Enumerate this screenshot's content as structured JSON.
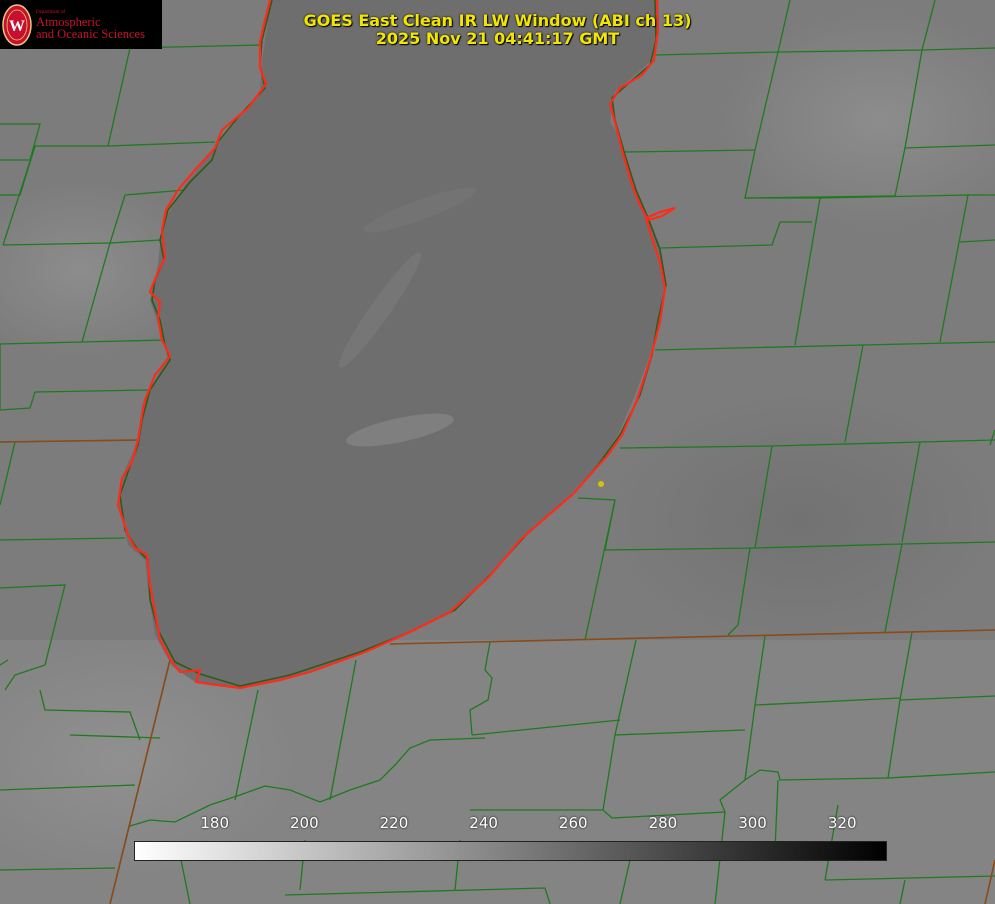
{
  "title": {
    "line1": "GOES East Clean IR LW Window (ABI ch 13)",
    "line2": "2025 Nov 21 04:41:17 GMT"
  },
  "logo": {
    "department": "Department of",
    "line1": "Atmospheric",
    "line2": "and Oceanic Sciences",
    "seal_letter": "W"
  },
  "colorbar": {
    "min": 162,
    "max": 330,
    "ticks": [
      "180",
      "200",
      "220",
      "240",
      "260",
      "280",
      "300",
      "320"
    ],
    "gradient_from": "#ffffff",
    "gradient_to": "#000000"
  },
  "colors": {
    "county_lines": "#1f7a1f",
    "state_lines": "#8a4a1a",
    "lake_outline": "#ff2a1a",
    "marker": "#d4c300",
    "title_text": "#f2e600"
  }
}
